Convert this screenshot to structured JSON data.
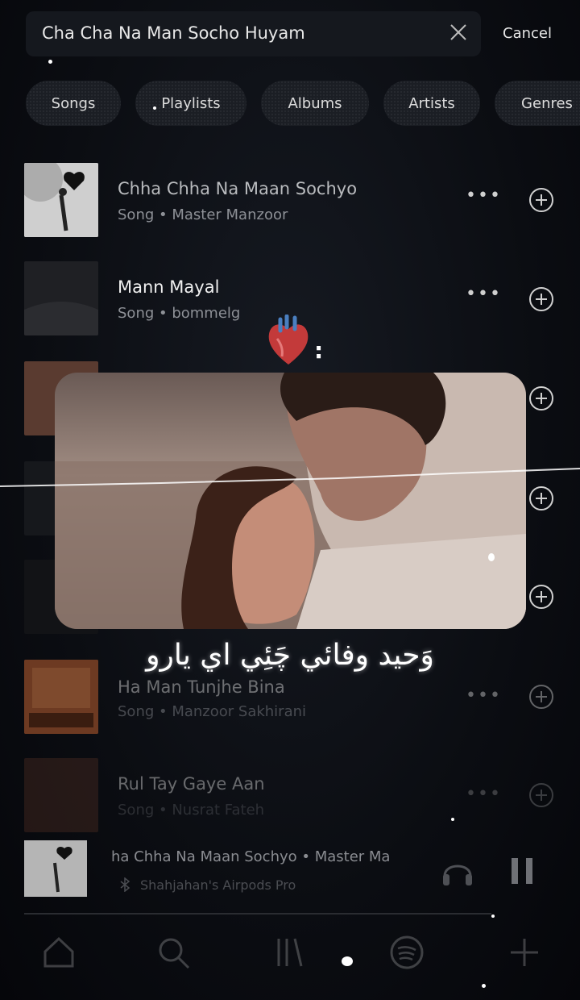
{
  "search": {
    "query": "Cha Cha Na Man Socho Huyam",
    "cancel_label": "Cancel"
  },
  "filters": [
    "Songs",
    "Playlists",
    "Albums",
    "Artists",
    "Genres"
  ],
  "results": [
    {
      "title": "Chha Chha Na Maan Sochyo",
      "subtitle": "Song • Master Manzoor"
    },
    {
      "title": "Mann Mayal",
      "subtitle": "Song • bommelg"
    },
    {
      "title": "Ha Man Tunjhe Bina",
      "subtitle": "Song • Manzoor Sakhirani"
    },
    {
      "title": "Rul Tay Gaye Aan",
      "subtitle": "Song • Nusrat Fateh"
    }
  ],
  "overlay": {
    "caption": "وَحيد وفائي چَئِي اي يارو",
    "heart": "heart-anatomical-icon"
  },
  "now_playing": {
    "title": "ha Chha Na Maan Sochyo • Master Ma",
    "device": "Shahjahan's Airpods Pro"
  },
  "nav": [
    "home-icon",
    "search-icon",
    "library-icon",
    "spotify-icon",
    "plus-icon"
  ],
  "colors": {
    "background": "#0b0d12",
    "chip": "#1b1e24",
    "text": "#e6e6e6",
    "muted": "#8d9096"
  }
}
